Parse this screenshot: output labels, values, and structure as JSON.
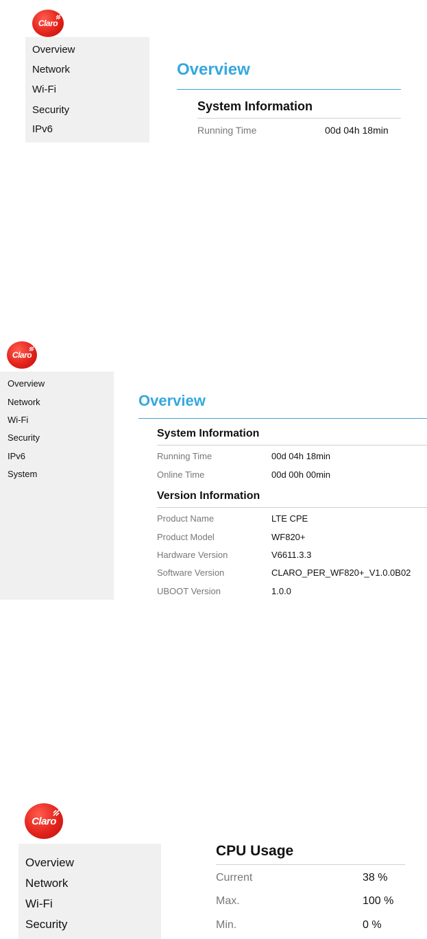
{
  "brand": {
    "logo_text": "Claro",
    "logo_color": "#e3231b",
    "accent_color": "#35a8de"
  },
  "panel1": {
    "nav": [
      "Overview",
      "Network",
      "Wi-Fi",
      "Security",
      "IPv6"
    ],
    "page_title": "Overview",
    "system": {
      "title": "System Information",
      "rows": [
        {
          "label": "Running Time",
          "value": "00d 04h 18min"
        }
      ]
    }
  },
  "panel2": {
    "nav": [
      "Overview",
      "Network",
      "Wi-Fi",
      "Security",
      "IPv6",
      "System"
    ],
    "page_title": "Overview",
    "system": {
      "title": "System Information",
      "rows": [
        {
          "label": "Running Time",
          "value": "00d 04h 18min"
        },
        {
          "label": "Online Time",
          "value": "00d 00h 00min"
        }
      ]
    },
    "version": {
      "title": "Version Information",
      "rows": [
        {
          "label": "Product Name",
          "value": "LTE CPE"
        },
        {
          "label": "Product Model",
          "value": "WF820+"
        },
        {
          "label": "Hardware Version",
          "value": "V6611.3.3"
        },
        {
          "label": "Software Version",
          "value": "CLARO_PER_WF820+_V1.0.0B02"
        },
        {
          "label": "UBOOT Version",
          "value": "1.0.0"
        }
      ]
    }
  },
  "panel3": {
    "nav": [
      "Overview",
      "Network",
      "Wi-Fi",
      "Security"
    ],
    "cpu": {
      "title": "CPU Usage",
      "rows": [
        {
          "label": "Current",
          "value": "38 %"
        },
        {
          "label": "Max.",
          "value": "100 %"
        },
        {
          "label": "Min.",
          "value": "0 %"
        }
      ]
    }
  }
}
